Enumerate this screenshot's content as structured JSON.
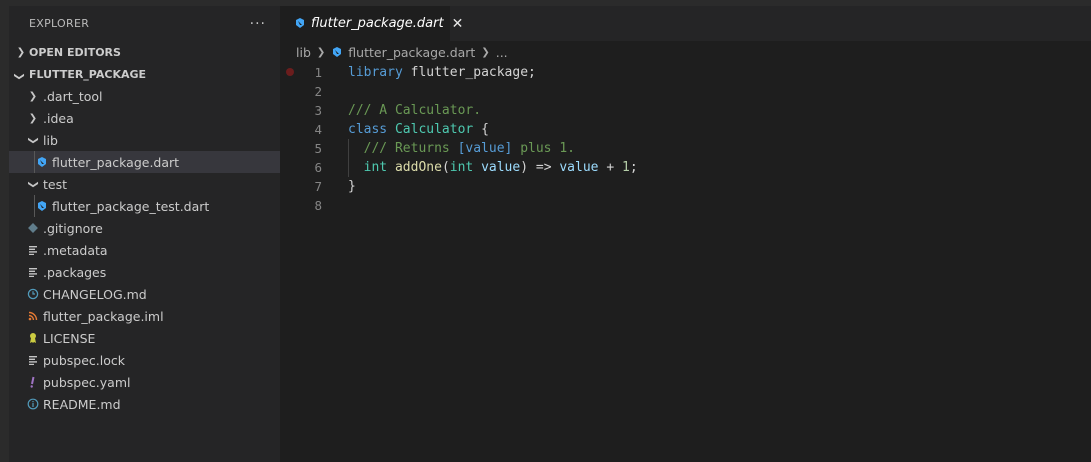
{
  "explorer": {
    "title": "EXPLORER",
    "more": "···",
    "open_editors": "OPEN EDITORS",
    "project": "FLUTTER_PACKAGE"
  },
  "tree": [
    {
      "label": ".dart_tool",
      "type": "folder",
      "chevron": "›",
      "depth": 1
    },
    {
      "label": ".idea",
      "type": "folder",
      "chevron": "›",
      "depth": 1
    },
    {
      "label": "lib",
      "type": "folder-open",
      "chevron": "⌄",
      "depth": 1
    },
    {
      "label": "flutter_package.dart",
      "type": "dart",
      "depth": 2,
      "selected": true
    },
    {
      "label": "test",
      "type": "folder-open",
      "chevron": "⌄",
      "depth": 1
    },
    {
      "label": "flutter_package_test.dart",
      "type": "dart",
      "depth": 2
    },
    {
      "label": ".gitignore",
      "type": "git",
      "depth": 1
    },
    {
      "label": ".metadata",
      "type": "lines",
      "depth": 1
    },
    {
      "label": ".packages",
      "type": "lines",
      "depth": 1
    },
    {
      "label": "CHANGELOG.md",
      "type": "clock",
      "depth": 1
    },
    {
      "label": "flutter_package.iml",
      "type": "rss",
      "depth": 1
    },
    {
      "label": "LICENSE",
      "type": "license",
      "depth": 1
    },
    {
      "label": "pubspec.lock",
      "type": "lines",
      "depth": 1
    },
    {
      "label": "pubspec.yaml",
      "type": "yaml",
      "depth": 1
    },
    {
      "label": "README.md",
      "type": "info",
      "depth": 1
    }
  ],
  "tab": {
    "label": "flutter_package.dart",
    "close": "✕"
  },
  "breadcrumb": {
    "folder": "lib",
    "file": "flutter_package.dart",
    "more": "..."
  },
  "editor": {
    "lines": [
      {
        "n": "1",
        "tokens": [
          [
            "kw",
            "library"
          ],
          [
            "plain",
            " flutter_package;"
          ]
        ],
        "breakpoint": true
      },
      {
        "n": "2",
        "tokens": []
      },
      {
        "n": "3",
        "tokens": [
          [
            "cmt",
            "/// A Calculator."
          ]
        ]
      },
      {
        "n": "4",
        "tokens": [
          [
            "kw",
            "class"
          ],
          [
            "plain",
            " "
          ],
          [
            "cls",
            "Calculator"
          ],
          [
            "plain",
            " {"
          ]
        ]
      },
      {
        "n": "5",
        "tokens": [
          [
            "plain",
            "  "
          ],
          [
            "cmt",
            "/// Returns "
          ],
          [
            "ref",
            "[value]"
          ],
          [
            "cmt",
            " plus 1."
          ]
        ]
      },
      {
        "n": "6",
        "tokens": [
          [
            "plain",
            "  "
          ],
          [
            "cls",
            "int"
          ],
          [
            "plain",
            " "
          ],
          [
            "fn",
            "addOne"
          ],
          [
            "plain",
            "("
          ],
          [
            "cls",
            "int"
          ],
          [
            "plain",
            " "
          ],
          [
            "var",
            "value"
          ],
          [
            "plain",
            ") => "
          ],
          [
            "var",
            "value"
          ],
          [
            "plain",
            " + "
          ],
          [
            "num",
            "1"
          ],
          [
            "plain",
            ";"
          ]
        ]
      },
      {
        "n": "7",
        "tokens": [
          [
            "plain",
            "}"
          ]
        ]
      },
      {
        "n": "8",
        "tokens": []
      }
    ]
  },
  "colors": {
    "dart_icon": "#42a5f5",
    "git_icon": "#607d8b",
    "changelog_icon": "#519aba",
    "rss_icon": "#e37933",
    "license_icon": "#cbcb41",
    "yaml_icon": "#a074c4",
    "info_icon": "#519aba",
    "breakpoint": "#6b1d1d"
  }
}
